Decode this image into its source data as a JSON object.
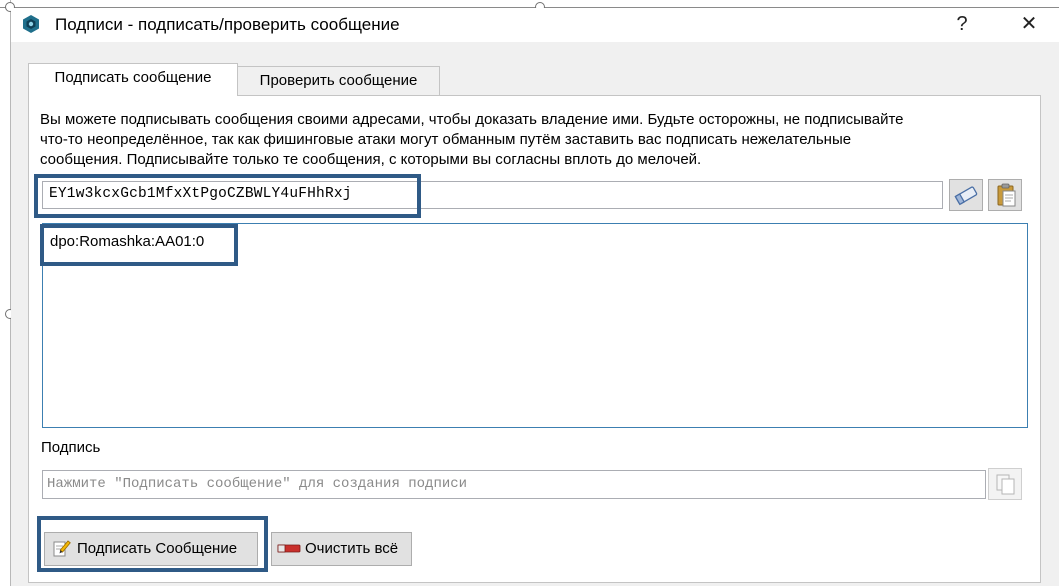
{
  "window": {
    "title": "Подписи - подписать/проверить сообщение",
    "help_label": "?",
    "close_label": "✕",
    "icon": "app-hexagon-icon"
  },
  "tabs": [
    {
      "label": "Подписать сообщение",
      "active": true
    },
    {
      "label": "Проверить сообщение",
      "active": false
    }
  ],
  "description": {
    "line1": "Вы можете подписывать сообщения своими адресами, чтобы доказать владение ими. Будьте осторожны, не подписывайте",
    "line2": "что-то неопределённое, так как фишинговые атаки могут обманным путём заставить вас подписать нежелательные",
    "line3": "сообщения. Подписывайте только те сообщения, с которыми вы согласны вплоть до мелочей."
  },
  "address": {
    "value": "EY1w3kcxGcb1MfxXtPgoCZBWLY4uFHhRxj",
    "address_book_icon": "address-book-icon",
    "paste_icon": "paste-icon"
  },
  "message": {
    "value": "dpo:Romashka:AA01:0"
  },
  "signature": {
    "label": "Подпись",
    "placeholder": "Нажмите \"Подписать сообщение\" для создания подписи",
    "copy_icon": "copy-icon"
  },
  "buttons": {
    "sign_label": "Подписать Сообщение",
    "clear_label": "Очистить всё"
  },
  "colors": {
    "highlight": "#2f5a86",
    "focus_border": "#3c7fb1",
    "dialog_bg": "#f0f0f0"
  }
}
